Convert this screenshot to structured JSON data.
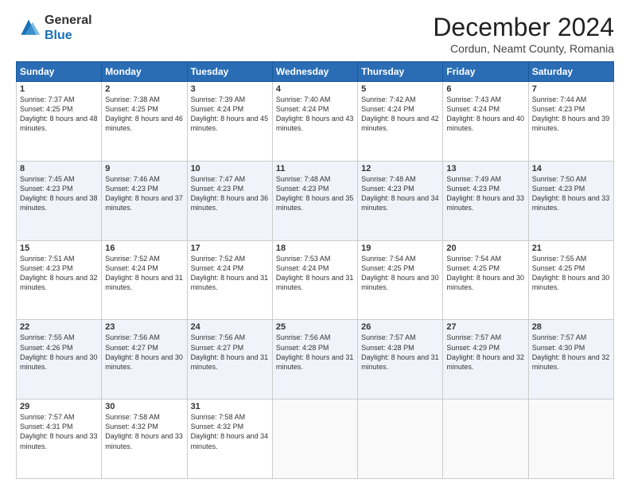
{
  "header": {
    "logo_line1": "General",
    "logo_line2": "Blue",
    "month_title": "December 2024",
    "subtitle": "Cordun, Neamt County, Romania"
  },
  "weekdays": [
    "Sunday",
    "Monday",
    "Tuesday",
    "Wednesday",
    "Thursday",
    "Friday",
    "Saturday"
  ],
  "weeks": [
    [
      {
        "day": "1",
        "sunrise": "Sunrise: 7:37 AM",
        "sunset": "Sunset: 4:25 PM",
        "daylight": "Daylight: 8 hours and 48 minutes."
      },
      {
        "day": "2",
        "sunrise": "Sunrise: 7:38 AM",
        "sunset": "Sunset: 4:25 PM",
        "daylight": "Daylight: 8 hours and 46 minutes."
      },
      {
        "day": "3",
        "sunrise": "Sunrise: 7:39 AM",
        "sunset": "Sunset: 4:24 PM",
        "daylight": "Daylight: 8 hours and 45 minutes."
      },
      {
        "day": "4",
        "sunrise": "Sunrise: 7:40 AM",
        "sunset": "Sunset: 4:24 PM",
        "daylight": "Daylight: 8 hours and 43 minutes."
      },
      {
        "day": "5",
        "sunrise": "Sunrise: 7:42 AM",
        "sunset": "Sunset: 4:24 PM",
        "daylight": "Daylight: 8 hours and 42 minutes."
      },
      {
        "day": "6",
        "sunrise": "Sunrise: 7:43 AM",
        "sunset": "Sunset: 4:24 PM",
        "daylight": "Daylight: 8 hours and 40 minutes."
      },
      {
        "day": "7",
        "sunrise": "Sunrise: 7:44 AM",
        "sunset": "Sunset: 4:23 PM",
        "daylight": "Daylight: 8 hours and 39 minutes."
      }
    ],
    [
      {
        "day": "8",
        "sunrise": "Sunrise: 7:45 AM",
        "sunset": "Sunset: 4:23 PM",
        "daylight": "Daylight: 8 hours and 38 minutes."
      },
      {
        "day": "9",
        "sunrise": "Sunrise: 7:46 AM",
        "sunset": "Sunset: 4:23 PM",
        "daylight": "Daylight: 8 hours and 37 minutes."
      },
      {
        "day": "10",
        "sunrise": "Sunrise: 7:47 AM",
        "sunset": "Sunset: 4:23 PM",
        "daylight": "Daylight: 8 hours and 36 minutes."
      },
      {
        "day": "11",
        "sunrise": "Sunrise: 7:48 AM",
        "sunset": "Sunset: 4:23 PM",
        "daylight": "Daylight: 8 hours and 35 minutes."
      },
      {
        "day": "12",
        "sunrise": "Sunrise: 7:48 AM",
        "sunset": "Sunset: 4:23 PM",
        "daylight": "Daylight: 8 hours and 34 minutes."
      },
      {
        "day": "13",
        "sunrise": "Sunrise: 7:49 AM",
        "sunset": "Sunset: 4:23 PM",
        "daylight": "Daylight: 8 hours and 33 minutes."
      },
      {
        "day": "14",
        "sunrise": "Sunrise: 7:50 AM",
        "sunset": "Sunset: 4:23 PM",
        "daylight": "Daylight: 8 hours and 33 minutes."
      }
    ],
    [
      {
        "day": "15",
        "sunrise": "Sunrise: 7:51 AM",
        "sunset": "Sunset: 4:23 PM",
        "daylight": "Daylight: 8 hours and 32 minutes."
      },
      {
        "day": "16",
        "sunrise": "Sunrise: 7:52 AM",
        "sunset": "Sunset: 4:24 PM",
        "daylight": "Daylight: 8 hours and 31 minutes."
      },
      {
        "day": "17",
        "sunrise": "Sunrise: 7:52 AM",
        "sunset": "Sunset: 4:24 PM",
        "daylight": "Daylight: 8 hours and 31 minutes."
      },
      {
        "day": "18",
        "sunrise": "Sunrise: 7:53 AM",
        "sunset": "Sunset: 4:24 PM",
        "daylight": "Daylight: 8 hours and 31 minutes."
      },
      {
        "day": "19",
        "sunrise": "Sunrise: 7:54 AM",
        "sunset": "Sunset: 4:25 PM",
        "daylight": "Daylight: 8 hours and 30 minutes."
      },
      {
        "day": "20",
        "sunrise": "Sunrise: 7:54 AM",
        "sunset": "Sunset: 4:25 PM",
        "daylight": "Daylight: 8 hours and 30 minutes."
      },
      {
        "day": "21",
        "sunrise": "Sunrise: 7:55 AM",
        "sunset": "Sunset: 4:25 PM",
        "daylight": "Daylight: 8 hours and 30 minutes."
      }
    ],
    [
      {
        "day": "22",
        "sunrise": "Sunrise: 7:55 AM",
        "sunset": "Sunset: 4:26 PM",
        "daylight": "Daylight: 8 hours and 30 minutes."
      },
      {
        "day": "23",
        "sunrise": "Sunrise: 7:56 AM",
        "sunset": "Sunset: 4:27 PM",
        "daylight": "Daylight: 8 hours and 30 minutes."
      },
      {
        "day": "24",
        "sunrise": "Sunrise: 7:56 AM",
        "sunset": "Sunset: 4:27 PM",
        "daylight": "Daylight: 8 hours and 31 minutes."
      },
      {
        "day": "25",
        "sunrise": "Sunrise: 7:56 AM",
        "sunset": "Sunset: 4:28 PM",
        "daylight": "Daylight: 8 hours and 31 minutes."
      },
      {
        "day": "26",
        "sunrise": "Sunrise: 7:57 AM",
        "sunset": "Sunset: 4:28 PM",
        "daylight": "Daylight: 8 hours and 31 minutes."
      },
      {
        "day": "27",
        "sunrise": "Sunrise: 7:57 AM",
        "sunset": "Sunset: 4:29 PM",
        "daylight": "Daylight: 8 hours and 32 minutes."
      },
      {
        "day": "28",
        "sunrise": "Sunrise: 7:57 AM",
        "sunset": "Sunset: 4:30 PM",
        "daylight": "Daylight: 8 hours and 32 minutes."
      }
    ],
    [
      {
        "day": "29",
        "sunrise": "Sunrise: 7:57 AM",
        "sunset": "Sunset: 4:31 PM",
        "daylight": "Daylight: 8 hours and 33 minutes."
      },
      {
        "day": "30",
        "sunrise": "Sunrise: 7:58 AM",
        "sunset": "Sunset: 4:32 PM",
        "daylight": "Daylight: 8 hours and 33 minutes."
      },
      {
        "day": "31",
        "sunrise": "Sunrise: 7:58 AM",
        "sunset": "Sunset: 4:32 PM",
        "daylight": "Daylight: 8 hours and 34 minutes."
      },
      null,
      null,
      null,
      null
    ]
  ]
}
